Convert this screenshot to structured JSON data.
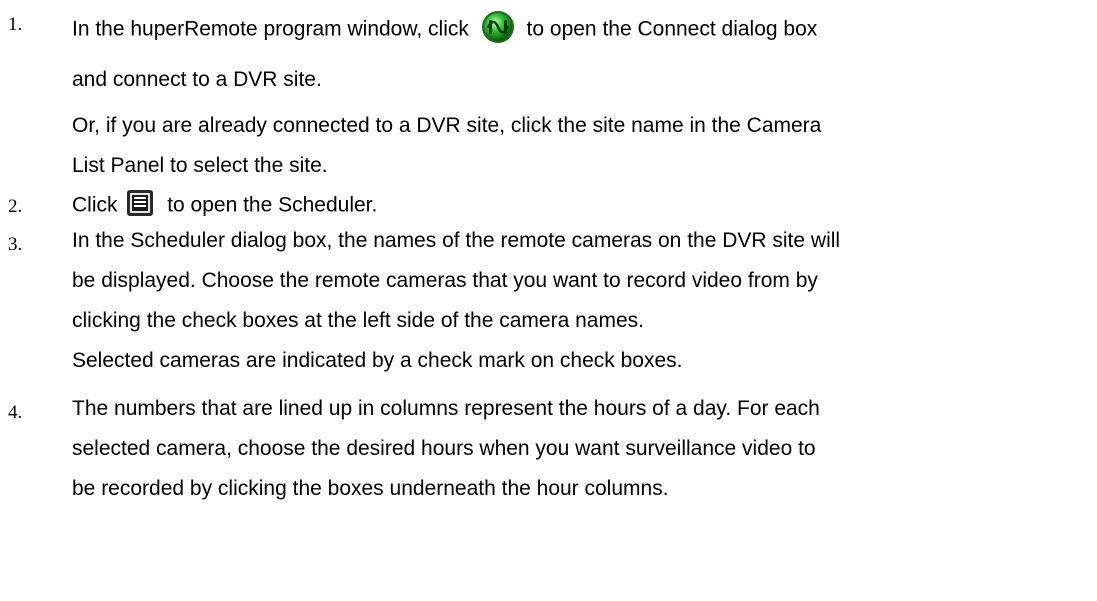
{
  "steps": [
    {
      "number": "1.",
      "lines": [
        {
          "before": "In the huperRemote program window, click",
          "icon": "connect-icon",
          "after": "to open the Connect dialog box"
        },
        {
          "text": "and connect to a DVR site."
        },
        {
          "text": "Or, if you are already connected to a DVR site, click the site name in the Camera"
        },
        {
          "text": "List Panel to select the site."
        }
      ]
    },
    {
      "number": "2.",
      "lines": [
        {
          "before": "Click",
          "icon": "scheduler-icon",
          "after": "to open the Scheduler."
        }
      ]
    },
    {
      "number": "3.",
      "lines": [
        {
          "text": "In the Scheduler dialog box, the names of the remote cameras on the DVR site will"
        },
        {
          "text": "be displayed. Choose the remote cameras that you want to record video from by"
        },
        {
          "text": "clicking the check boxes at the left side of the camera names."
        },
        {
          "text": "Selected cameras are indicated by a check mark on check boxes."
        }
      ]
    },
    {
      "number": "4.",
      "lines": [
        {
          "text": "The numbers that are lined up in columns represent the hours of a day. For each"
        },
        {
          "text": "selected camera, choose the desired hours when you want surveillance video to"
        },
        {
          "text": "be recorded by clicking the boxes underneath the hour columns."
        }
      ]
    }
  ]
}
